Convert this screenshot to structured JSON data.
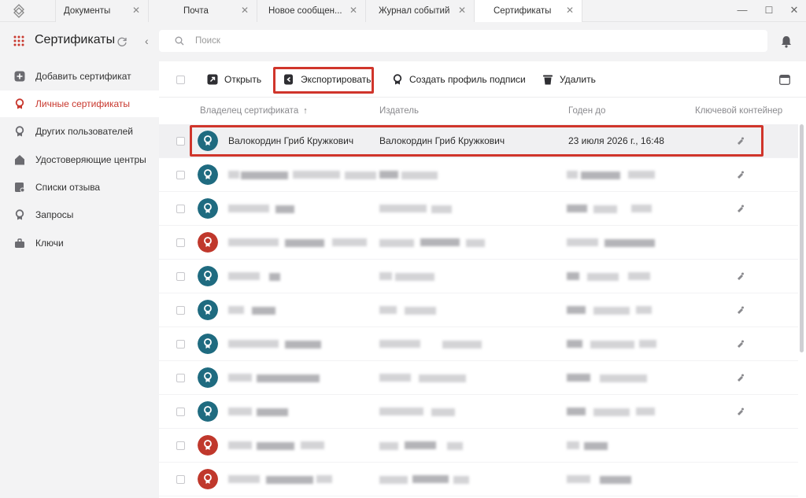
{
  "window": {
    "tabs": [
      {
        "label": "Документы",
        "active": false
      },
      {
        "label": "Почта",
        "active": false
      },
      {
        "label": "Новое сообщен...",
        "active": false
      },
      {
        "label": "Журнал событий",
        "active": false
      },
      {
        "label": "Сертификаты",
        "active": true
      }
    ],
    "controls": {
      "minimize": "—",
      "maximize": "☐",
      "close": "✕"
    }
  },
  "sidebar": {
    "title": "Сертификаты",
    "items": [
      {
        "label": "Добавить сертификат",
        "icon": "plus-square-icon",
        "active": false
      },
      {
        "label": "Личные сертификаты",
        "icon": "certificate-icon",
        "active": true
      },
      {
        "label": "Других пользователей",
        "icon": "certificate-icon",
        "active": false
      },
      {
        "label": "Удостоверяющие центры",
        "icon": "house-icon",
        "active": false
      },
      {
        "label": "Списки отзыва",
        "icon": "revocation-list-icon",
        "active": false
      },
      {
        "label": "Запросы",
        "icon": "certificate-icon",
        "active": false
      },
      {
        "label": "Ключи",
        "icon": "key-case-icon",
        "active": false
      }
    ]
  },
  "search": {
    "placeholder": "Поиск",
    "value": ""
  },
  "toolbar": {
    "open_label": "Открыть",
    "export_label": "Экспортировать",
    "create_profile_label": "Создать профиль подписи",
    "delete_label": "Удалить"
  },
  "table": {
    "columns": {
      "owner": "Владелец сертификата",
      "issuer": "Издатель",
      "valid_until": "Годен до",
      "key_container": "Ключевой контейнер"
    },
    "selected_row": {
      "owner": "Валокордин Гриб Кружкович",
      "issuer": "Валокордин Гриб Кружкович",
      "valid_until": "23 июля 2026 г., 16:48"
    },
    "row_statuses": [
      "valid",
      "valid",
      "valid",
      "expired",
      "valid",
      "valid",
      "valid",
      "valid",
      "valid",
      "expired",
      "expired"
    ]
  },
  "colors": {
    "accent": "#c8372d",
    "highlight_box": "#d0352b",
    "valid_avatar": "#1f6b80",
    "expired_avatar": "#c0382c"
  }
}
